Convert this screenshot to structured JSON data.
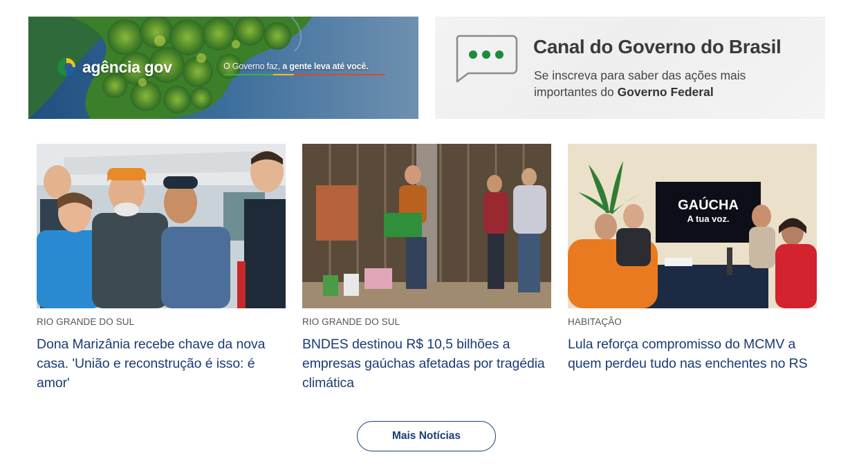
{
  "banners": {
    "left": {
      "brand": "agência gov",
      "slogan_prefix": "O Governo faz, ",
      "slogan_suffix": "a gente leva até você.",
      "colors": {
        "sky": "#2b5d94",
        "forest": "#3b7d2a",
        "water": "#3e6f9c"
      }
    },
    "right": {
      "title": "Canal do Governo do Brasil",
      "subtitle_line1": "Se inscreva para saber das ações mais",
      "subtitle_line2_prefix": "importantes do ",
      "subtitle_line2_bold": "Governo Federal",
      "accent": "#1e8a3c"
    }
  },
  "news": [
    {
      "category": "RIO GRANDE DO SUL",
      "title": "Dona Marizânia recebe chave da nova casa. 'União e reconstrução é isso: é amor'"
    },
    {
      "category": "RIO GRANDE DO SUL",
      "title": "BNDES destinou R$ 10,5 bilhões a empresas gaúchas afetadas por tragédia climática"
    },
    {
      "category": "HABITAÇÃO",
      "title": "Lula reforça compromisso do MCMV a quem perdeu tudo nas enchentes no RS",
      "screen_text_line1": "GAÚCHA",
      "screen_text_line2": "A tua voz."
    }
  ],
  "more_button": "Mais Notícias",
  "colors": {
    "link": "#1a3b73",
    "category": "#555555"
  }
}
